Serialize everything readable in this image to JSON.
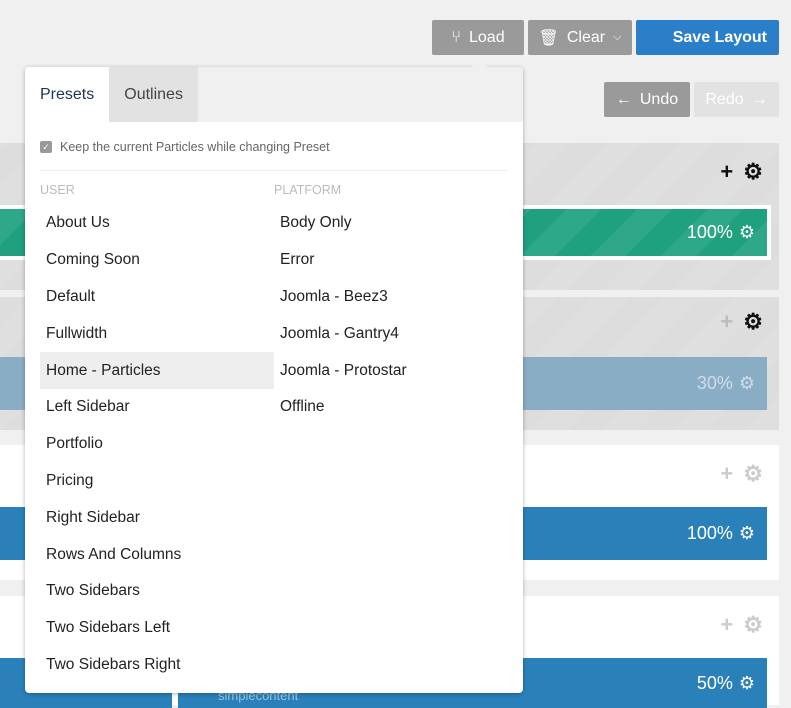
{
  "toolbar": {
    "load": "Load",
    "clear": "Clear",
    "save": "Save Layout",
    "undo": "Undo",
    "redo": "Redo"
  },
  "sections": [
    {
      "percent": "100%",
      "color": "#1fa180"
    },
    {
      "percent": "30%",
      "color": "#8aadc6"
    },
    {
      "percent": "100%",
      "color": "#2a81ba"
    },
    {
      "percent": "50%",
      "color": "#2a81ba",
      "label": "simplecontent"
    }
  ],
  "dropdown": {
    "tabs": [
      {
        "label": "Presets",
        "active": true
      },
      {
        "label": "Outlines",
        "active": false
      }
    ],
    "keep_label": "Keep the current Particles while changing Preset",
    "keep_checked": true,
    "user_header": "USER",
    "platform_header": "PLATFORM",
    "user": [
      "About Us",
      "Coming Soon",
      "Default",
      "Fullwidth",
      "Home - Particles",
      "Left Sidebar",
      "Portfolio",
      "Pricing",
      "Right Sidebar",
      "Rows And Columns",
      "Two Sidebars",
      "Two Sidebars Left",
      "Two Sidebars Right"
    ],
    "selected": "Home - Particles",
    "platform": [
      "Body Only",
      "Error",
      "Joomla - Beez3",
      "Joomla - Gantry4",
      "Joomla - Protostar",
      "Offline"
    ]
  }
}
